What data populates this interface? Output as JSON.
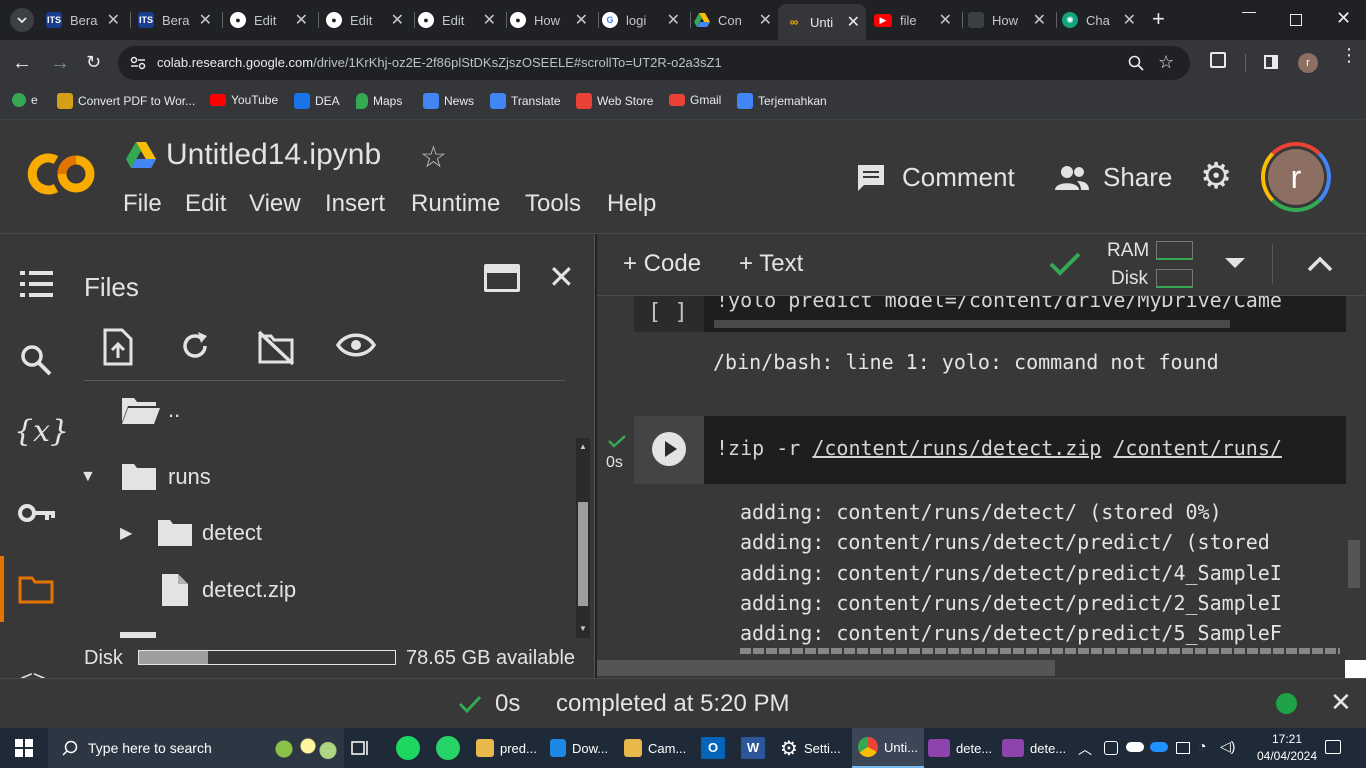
{
  "browser": {
    "tabs": [
      {
        "label": "Bera",
        "icon": "its-icon",
        "color": "#1a3d8f"
      },
      {
        "label": "Bera",
        "icon": "its-icon",
        "color": "#1a3d8f"
      },
      {
        "label": "Edit",
        "icon": "github-icon",
        "color": "#ffffff"
      },
      {
        "label": "Edit",
        "icon": "github-icon",
        "color": "#ffffff"
      },
      {
        "label": "Edit",
        "icon": "github-icon",
        "color": "#ffffff"
      },
      {
        "label": "How",
        "icon": "github-icon",
        "color": "#ffffff"
      },
      {
        "label": "logi",
        "icon": "google-icon",
        "color": "#4285f4"
      },
      {
        "label": "Con",
        "icon": "drive-icon",
        "color": "#fbbc04"
      },
      {
        "label": "Unti",
        "icon": "colab-icon",
        "color": "#f9ab00"
      },
      {
        "label": "file",
        "icon": "youtube-icon",
        "color": "#ff0000"
      },
      {
        "label": "How",
        "icon": "tab-icon",
        "color": "#5f6368"
      },
      {
        "label": "Cha",
        "icon": "chatgpt-icon",
        "color": "#10a37f"
      }
    ],
    "url_host": "colab.research.google.com",
    "url_path": "/drive/1KrKhj-oz2E-2f86plStDKsZjszOSEELE#scrollTo=UT2R-o2a3sZ1",
    "profile_initial": "r",
    "bookmarks": [
      {
        "label": "e",
        "color": "#34a853"
      },
      {
        "label": "Convert PDF to Wor...",
        "color": "#d4a017"
      },
      {
        "label": "YouTube",
        "color": "#ff0000"
      },
      {
        "label": "DEA",
        "color": "#1a73e8"
      },
      {
        "label": "Maps",
        "color": "#34a853"
      },
      {
        "label": "News",
        "color": "#4285f4"
      },
      {
        "label": "Translate",
        "color": "#4285f4"
      },
      {
        "label": "Web Store",
        "color": "#ea4335"
      },
      {
        "label": "Gmail",
        "color": "#ea4335"
      },
      {
        "label": "Terjemahkan",
        "color": "#4285f4"
      }
    ]
  },
  "colab": {
    "logo": "CO",
    "notebook_title": "Untitled14.ipynb",
    "menu": [
      "File",
      "Edit",
      "View",
      "Insert",
      "Runtime",
      "Tools",
      "Help"
    ],
    "comment_label": "Comment",
    "share_label": "Share",
    "avatar_initial": "r",
    "add_code_label": "+ Code",
    "add_text_label": "+ Text",
    "ram_label": "RAM",
    "disk_label": "Disk"
  },
  "files": {
    "title": "Files",
    "tree": [
      {
        "label": "..",
        "type": "folder"
      },
      {
        "label": "runs",
        "type": "folder",
        "expanded": true
      },
      {
        "label": "detect",
        "type": "folder",
        "expanded": false
      },
      {
        "label": "detect.zip",
        "type": "file"
      }
    ],
    "disk_label": "Disk",
    "disk_available": "78.65 GB available",
    "disk_used_fraction": 0.27
  },
  "cells": [
    {
      "exec_count": "[ ]",
      "code": "!yolo predict model=/content/drive/MyDrive/Came",
      "output": [
        "/bin/bash: line 1: yolo: command not found"
      ]
    },
    {
      "time": "0s",
      "code_prefix": "!zip -r ",
      "code_arg1": "/content/runs/detect.zip",
      "code_arg2": "/content/runs/",
      "output": [
        "adding: content/runs/detect/ (stored 0%)",
        "adding: content/runs/detect/predict/ (stored",
        "adding: content/runs/detect/predict/4_SampleI",
        "adding: content/runs/detect/predict/2_SampleI",
        "adding: content/runs/detect/predict/5_SampleF"
      ]
    }
  ],
  "status": {
    "time": "0s",
    "message": "completed at 5:20 PM"
  },
  "taskbar": {
    "search_placeholder": "Type here to search",
    "apps": [
      {
        "label": "pred...",
        "color": "#e8b84a"
      },
      {
        "label": "Dow...",
        "color": "#1e88e5"
      },
      {
        "label": "Cam...",
        "color": "#e8b84a"
      },
      {
        "label": "Setti...",
        "color": "#ffffff"
      },
      {
        "label": "Unti...",
        "color": "#4285f4"
      },
      {
        "label": "dete...",
        "color": "#8e44ad"
      },
      {
        "label": "dete...",
        "color": "#8e44ad"
      }
    ],
    "time": "17:21",
    "date": "04/04/2024"
  }
}
